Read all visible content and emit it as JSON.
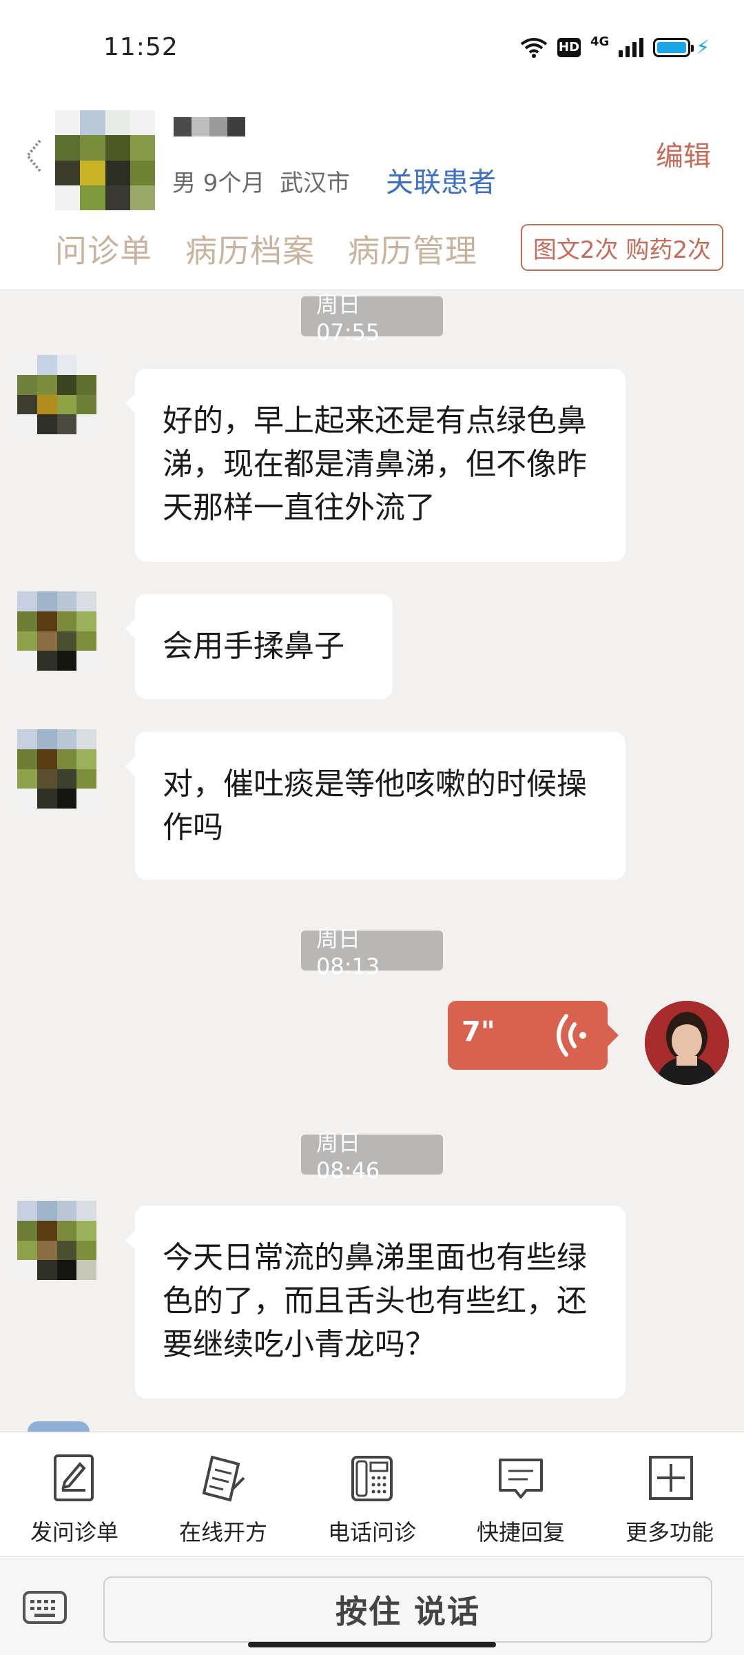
{
  "status_bar": {
    "time": "11:52",
    "hd_badge": "HD",
    "network": "4G"
  },
  "header": {
    "patient_info": "男 9个月  武汉市",
    "link_patient": "关联患者",
    "edit": "编辑",
    "tabs": [
      "问诊单",
      "病历档案",
      "病历管理"
    ],
    "stat_badge": "图文2次 购药2次"
  },
  "chat": {
    "messages": [
      {
        "timestamp": "周日 07:55"
      },
      {
        "sender": "patient",
        "text": "好的，早上起来还是有点绿色鼻涕，现在都是清鼻涕，但不像昨天那样一直往外流了"
      },
      {
        "sender": "patient",
        "text": "会用手揉鼻子"
      },
      {
        "sender": "patient",
        "text": "对，催吐痰是等他咳嗽的时候操作吗"
      },
      {
        "timestamp": "周日 08:13"
      },
      {
        "sender": "doctor",
        "type": "voice",
        "duration": "7\""
      },
      {
        "timestamp": "周日 08:46"
      },
      {
        "sender": "patient",
        "text": "今天日常流的鼻涕里面也有些绿色的了，而且舌头也有些红，还要继续吃小青龙吗？"
      }
    ]
  },
  "toolbar": {
    "items": [
      {
        "label": "发问诊单",
        "icon": "form-edit-icon"
      },
      {
        "label": "在线开方",
        "icon": "prescription-icon"
      },
      {
        "label": "电话问诊",
        "icon": "phone-icon"
      },
      {
        "label": "快捷回复",
        "icon": "message-icon"
      },
      {
        "label": "更多功能",
        "icon": "plus-icon"
      }
    ]
  },
  "input_bar": {
    "hold_to_talk": "按住 说话"
  },
  "colors": {
    "accent": "#d9624e",
    "link": "#3c6fc8",
    "tab_text": "#c9b39c",
    "timestamp_bg": "#b9b7b6",
    "chat_bg": "#f2f1f0"
  }
}
